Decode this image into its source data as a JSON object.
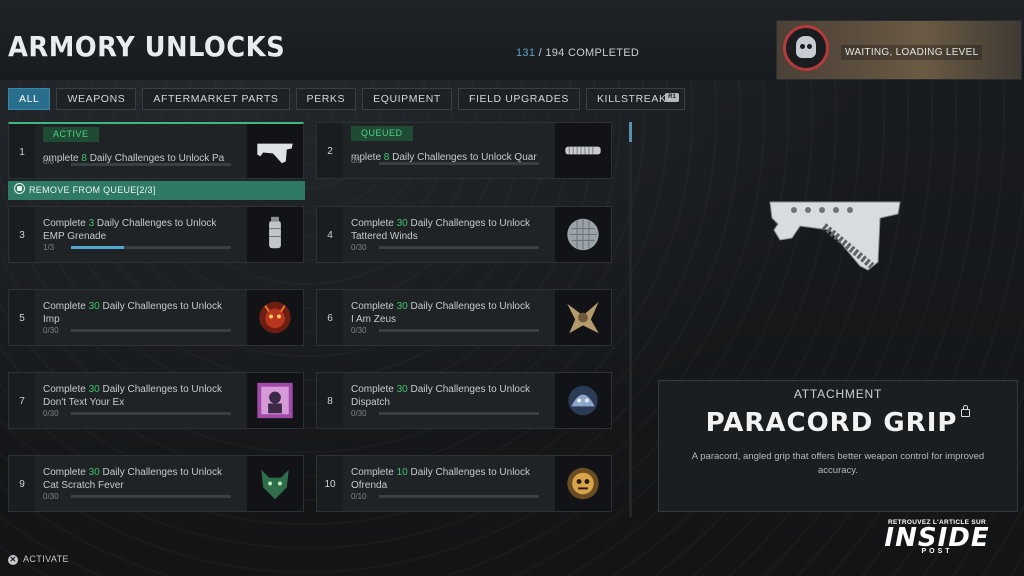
{
  "header": {
    "title": "ARMORY UNLOCKS",
    "completed": "131",
    "total_completed": "/ 194 COMPLETED",
    "player_status": "WAITING, LOADING LEVEL"
  },
  "tabs": [
    {
      "label": "ALL",
      "active": true
    },
    {
      "label": "WEAPONS"
    },
    {
      "label": "AFTERMARKET PARTS"
    },
    {
      "label": "PERKS"
    },
    {
      "label": "EQUIPMENT"
    },
    {
      "label": "FIELD UPGRADES"
    },
    {
      "label": "KILLSTREAKS"
    }
  ],
  "rb_label": "R1",
  "queue": {
    "remove_label": "REMOVE FROM QUEUE[2/3]"
  },
  "cards": [
    {
      "num": "1",
      "badge": "ACTIVE",
      "prefix": "omplete ",
      "count": "8",
      "suffix": " Daily Challenges to Unlock Pa",
      "name": "",
      "progress": "0/8",
      "fill": 0,
      "icon": "paracord-grip-icon"
    },
    {
      "num": "2",
      "badge": "QUEUED",
      "prefix": "mplete ",
      "count": "8",
      "suffix": " Daily Challenges to Unlock Quar",
      "name": "",
      "progress": "0/8",
      "fill": 0,
      "icon": "suppressor-icon"
    },
    {
      "num": "3",
      "prefix": "Complete ",
      "count": "3",
      "suffix": " Daily Challenges to Unlock",
      "name": "EMP Grenade",
      "progress": "1/3",
      "fill": 0.33,
      "icon": "emp-grenade-icon"
    },
    {
      "num": "4",
      "prefix": "Complete ",
      "count": "30",
      "suffix": " Daily Challenges to Unlock",
      "name": "Tattered Winds",
      "progress": "0/30",
      "fill": 0,
      "icon": "tattered-winds-icon"
    },
    {
      "num": "5",
      "prefix": "Complete ",
      "count": "30",
      "suffix": " Daily Challenges to Unlock",
      "name": "Imp",
      "progress": "0/30",
      "fill": 0,
      "icon": "imp-icon"
    },
    {
      "num": "6",
      "prefix": "Complete ",
      "count": "30",
      "suffix": " Daily Challenges to Unlock",
      "name": "I Am Zeus",
      "progress": "0/30",
      "fill": 0,
      "icon": "i-am-zeus-icon"
    },
    {
      "num": "7",
      "prefix": "Complete ",
      "count": "30",
      "suffix": " Daily Challenges to Unlock",
      "name": "Don't Text Your Ex",
      "progress": "0/30",
      "fill": 0,
      "icon": "dont-text-your-ex-icon"
    },
    {
      "num": "8",
      "prefix": "Complete ",
      "count": "30",
      "suffix": " Daily Challenges to Unlock",
      "name": "Dispatch",
      "progress": "0/30",
      "fill": 0,
      "icon": "dispatch-icon"
    },
    {
      "num": "9",
      "prefix": "Complete ",
      "count": "30",
      "suffix": " Daily Challenges to Unlock",
      "name": "Cat Scratch Fever",
      "progress": "0/30",
      "fill": 0,
      "icon": "cat-scratch-fever-icon"
    },
    {
      "num": "10",
      "prefix": "Complete ",
      "count": "10",
      "suffix": " Daily Challenges to Unlock",
      "name": "Ofrenda",
      "progress": "0/10",
      "fill": 0,
      "icon": "ofrenda-icon"
    }
  ],
  "details": {
    "type": "ATTACHMENT",
    "name": "PARACORD GRIP",
    "description": "A paracord, angled grip that offers better weapon control for improved accuracy."
  },
  "footer": {
    "activate_label": "ACTIVATE"
  },
  "watermark": {
    "line1": "RETROUVEZ L'ARTICLE SUR",
    "line2": "INSIDE",
    "line3": "POST"
  },
  "colors": {
    "accent_green": "#3fc46a",
    "accent_blue": "#2a6e8e",
    "progress_blue": "#52a7d1"
  }
}
